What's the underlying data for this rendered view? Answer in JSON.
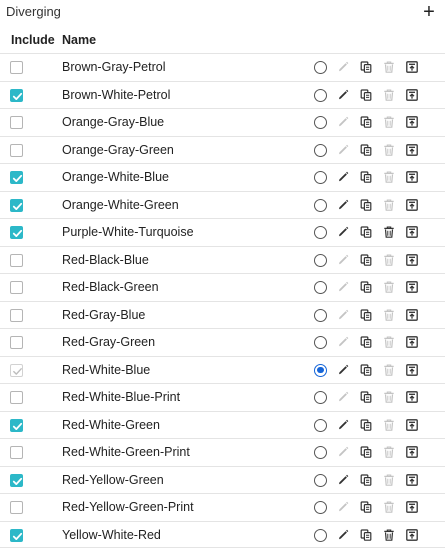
{
  "section": {
    "title": "Diverging",
    "add_label": "+"
  },
  "header": {
    "include": "Include",
    "name": "Name"
  },
  "colors": {
    "accent": "#2cb8c8",
    "radio_selected": "#1565d8",
    "icon_active": "#333333",
    "icon_disabled": "#c4c4c4"
  },
  "rows": [
    {
      "name": "Brown-Gray-Petrol",
      "included": false,
      "default": false,
      "editable": false
    },
    {
      "name": "Brown-White-Petrol",
      "included": true,
      "default": false,
      "editable": true
    },
    {
      "name": "Orange-Gray-Blue",
      "included": false,
      "default": false,
      "editable": false
    },
    {
      "name": "Orange-Gray-Green",
      "included": false,
      "default": false,
      "editable": false
    },
    {
      "name": "Orange-White-Blue",
      "included": true,
      "default": false,
      "editable": true
    },
    {
      "name": "Orange-White-Green",
      "included": true,
      "default": false,
      "editable": true
    },
    {
      "name": "Purple-White-Turquoise",
      "included": true,
      "default": false,
      "editable": true
    },
    {
      "name": "Red-Black-Blue",
      "included": false,
      "default": false,
      "editable": false
    },
    {
      "name": "Red-Black-Green",
      "included": false,
      "default": false,
      "editable": false
    },
    {
      "name": "Red-Gray-Blue",
      "included": false,
      "default": false,
      "editable": false
    },
    {
      "name": "Red-Gray-Green",
      "included": false,
      "default": false,
      "editable": false
    },
    {
      "name": "Red-White-Blue",
      "included": true,
      "included_disabled": true,
      "default": true,
      "editable": true
    },
    {
      "name": "Red-White-Blue-Print",
      "included": false,
      "default": false,
      "editable": false
    },
    {
      "name": "Red-White-Green",
      "included": true,
      "default": false,
      "editable": true
    },
    {
      "name": "Red-White-Green-Print",
      "included": false,
      "default": false,
      "editable": false
    },
    {
      "name": "Red-Yellow-Green",
      "included": true,
      "default": false,
      "editable": true
    },
    {
      "name": "Red-Yellow-Green-Print",
      "included": false,
      "default": false,
      "editable": false
    },
    {
      "name": "Yellow-White-Red",
      "included": true,
      "default": false,
      "editable": true
    }
  ]
}
